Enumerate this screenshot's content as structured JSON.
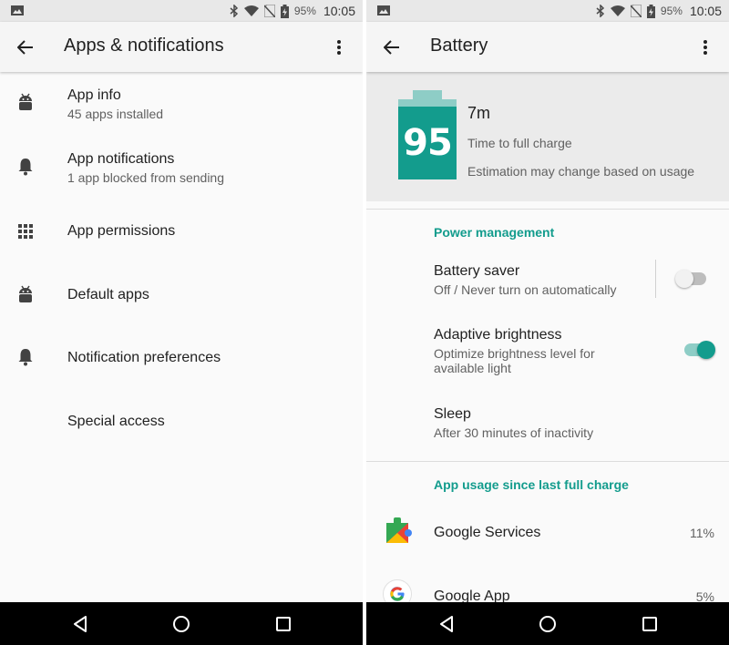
{
  "status_bar": {
    "battery_percent": "95%",
    "time": "10:05",
    "icons": [
      "image-icon",
      "bluetooth-icon",
      "wifi-icon",
      "no-sim-icon",
      "battery-charging-icon"
    ]
  },
  "apps_screen": {
    "title": "Apps & notifications",
    "items": [
      {
        "label": "App info",
        "subtitle": "45 apps installed",
        "icon": "android-icon"
      },
      {
        "label": "App notifications",
        "subtitle": "1 app blocked from sending",
        "icon": "bell-icon"
      },
      {
        "label": "App permissions",
        "subtitle": "",
        "icon": "grid-icon"
      },
      {
        "label": "Default apps",
        "subtitle": "",
        "icon": "android-icon"
      },
      {
        "label": "Notification preferences",
        "subtitle": "",
        "icon": "bell-icon"
      },
      {
        "label": "Special access",
        "subtitle": "",
        "icon": ""
      }
    ]
  },
  "battery_screen": {
    "title": "Battery",
    "battery_level": "95",
    "time_remaining": "7m",
    "time_label": "Time to full charge",
    "estimate_note": "Estimation may change based on usage",
    "power_section_label": "Power management",
    "settings": [
      {
        "label": "Battery saver",
        "subtitle": "Off / Never turn on automatically",
        "toggle": false
      },
      {
        "label": "Adaptive brightness",
        "subtitle": "Optimize brightness level for available light",
        "toggle": true
      },
      {
        "label": "Sleep",
        "subtitle": "After 30 minutes of inactivity"
      }
    ],
    "usage_section_label": "App usage since last full charge",
    "apps": [
      {
        "name": "Google Services",
        "percent": "11%",
        "icon": "google-services-icon"
      },
      {
        "name": "Google App",
        "percent": "5%",
        "icon": "google-app-icon"
      }
    ]
  },
  "colors": {
    "accent": "#139c8d",
    "accent_light": "#8ecdc6",
    "status_bar_bg": "#e8e8e8",
    "nav_bar_bg": "#000000"
  }
}
